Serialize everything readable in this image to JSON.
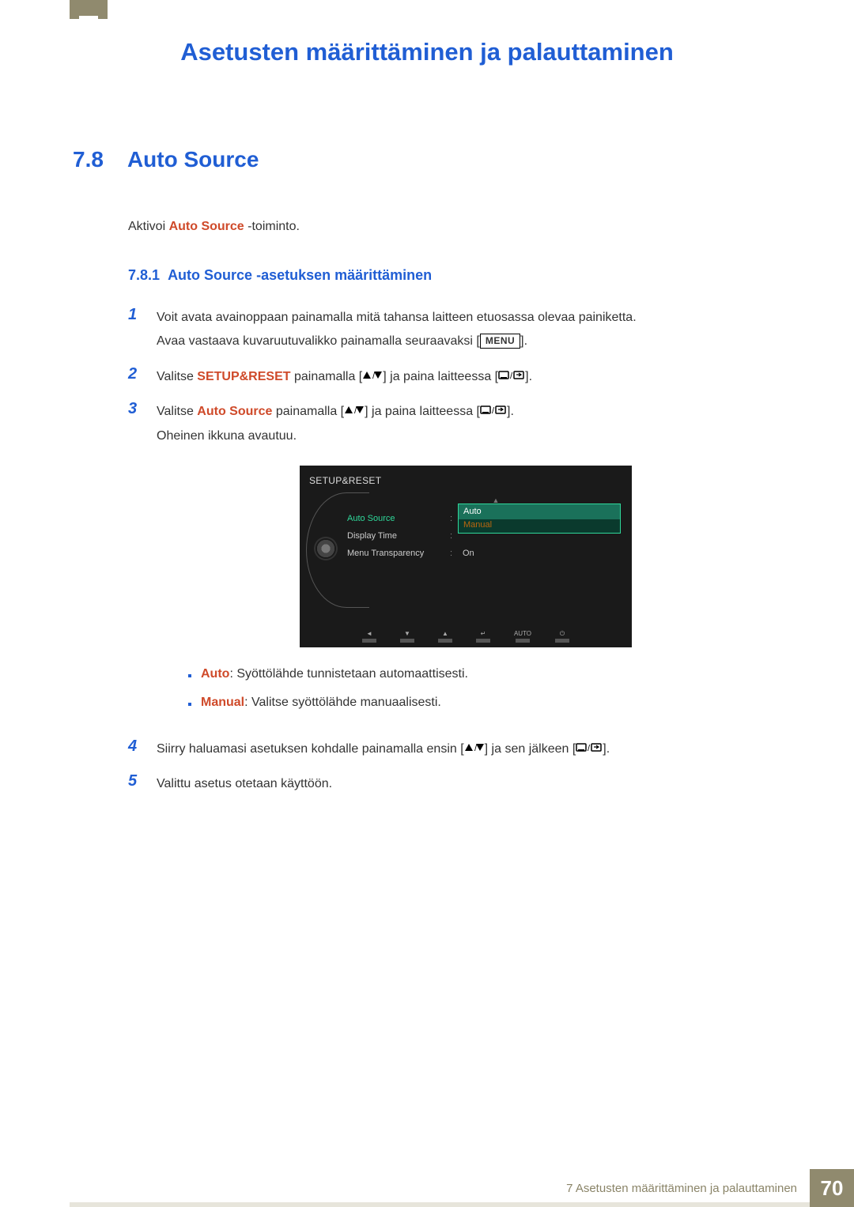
{
  "chapter": {
    "title": "Asetusten määrittäminen ja palauttaminen"
  },
  "section": {
    "number": "7.8",
    "title": "Auto Source"
  },
  "intro": {
    "pre": "Aktivoi ",
    "hl": "Auto Source",
    "post": " -toiminto."
  },
  "subsection": {
    "number": "7.8.1",
    "title": "Auto Source -asetuksen määrittäminen"
  },
  "menu_label": "MENU",
  "steps": {
    "s1": {
      "num": "1",
      "line1": "Voit avata avainoppaan painamalla mitä tahansa laitteen etuosassa olevaa painiketta.",
      "line2_pre": "Avaa vastaava kuvaruutuvalikko painamalla seuraavaksi [",
      "line2_post": "]."
    },
    "s2": {
      "num": "2",
      "pre": "Valitse ",
      "hl": "SETUP&RESET",
      "mid1": " painamalla [",
      "mid2": "] ja paina laitteessa [",
      "post": "]."
    },
    "s3": {
      "num": "3",
      "pre": "Valitse ",
      "hl": "Auto Source",
      "mid1": " painamalla [",
      "mid2": "] ja paina laitteessa [",
      "post": "].",
      "line2": "Oheinen ikkuna avautuu."
    },
    "s4": {
      "num": "4",
      "pre": "Siirry haluamasi asetuksen kohdalle painamalla ensin [",
      "mid": "] ja sen jälkeen [",
      "post": "]."
    },
    "s5": {
      "num": "5",
      "text": "Valittu asetus otetaan käyttöön."
    }
  },
  "bullets": {
    "b1": {
      "hl": "Auto",
      "text": ": Syöttölähde tunnistetaan automaattisesti."
    },
    "b2": {
      "hl": "Manual",
      "text": ": Valitse syöttölähde manuaalisesti."
    }
  },
  "osd": {
    "header": "SETUP&RESET",
    "rows": {
      "r1": {
        "label": "Auto Source",
        "opt_auto": "Auto",
        "opt_manual": "Manual"
      },
      "r2": {
        "label": "Display Time"
      },
      "r3": {
        "label": "Menu Transparency",
        "value": "On"
      }
    },
    "bottom_auto": "AUTO"
  },
  "footer": {
    "text": "7 Asetusten määrittäminen ja palauttaminen",
    "page": "70"
  }
}
